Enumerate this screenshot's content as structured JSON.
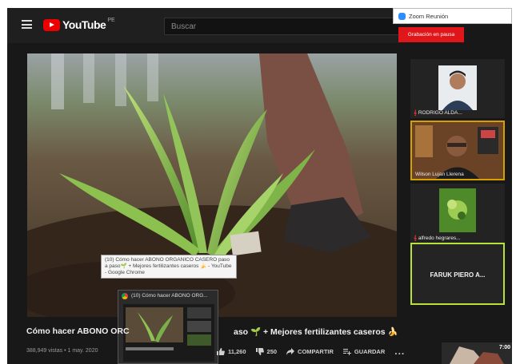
{
  "youtube": {
    "logo_text": "YouTube",
    "logo_suffix": "PE",
    "search_placeholder": "Buscar"
  },
  "tooltip": {
    "text": "(10) Cómo hacer ABONO ORGANICO CASERO paso a paso🌱 + Mejores fertilizantes caseros 🍌 - YouTube - Google Chrome"
  },
  "taskbar_thumb": {
    "title": "(10) Cómo hacer ABONO ORG..."
  },
  "video": {
    "title_left": "Cómo hacer ABONO ORC",
    "title_right": "aso 🌱 + Mejores fertilizantes caseros 🍌",
    "meta": "388,949 vistas • 1 may. 2020",
    "likes": "11,260",
    "dislikes": "250",
    "share_label": "COMPARTIR",
    "save_label": "GUARDAR",
    "more": "...",
    "next_duration": "7:00"
  },
  "zoom": {
    "window_title": "Zoom Reunión",
    "recording_status": "Grabación en pausa",
    "participants": [
      {
        "name": "RODRIGO ALDA..."
      },
      {
        "name": "Wilson Lujan Llerena"
      },
      {
        "name": "alfredo hegrares..."
      },
      {
        "name": "FARUK PIERO A..."
      }
    ]
  },
  "colors": {
    "youtube_red": "#e00000",
    "zoom_blue": "#2d8cff",
    "recording_red": "#e0161b",
    "active_speaker": "#b7e23a",
    "spotlight": "#d6a100"
  }
}
